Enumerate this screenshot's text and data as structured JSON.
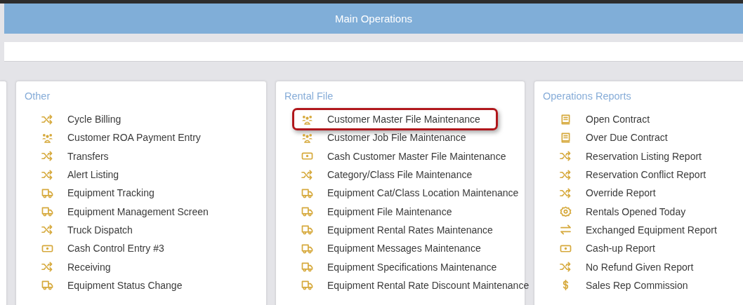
{
  "header": {
    "title": "Main Operations"
  },
  "panels": [
    {
      "title": "Other",
      "items": [
        {
          "label": "Cycle Billing",
          "kind": "shuffle",
          "highlighted": false
        },
        {
          "label": "Customer ROA Payment Entry",
          "kind": "users",
          "highlighted": false
        },
        {
          "label": "Transfers",
          "kind": "shuffle",
          "highlighted": false
        },
        {
          "label": "Alert Listing",
          "kind": "shuffle",
          "highlighted": false
        },
        {
          "label": "Equipment Tracking",
          "kind": "truck",
          "highlighted": false
        },
        {
          "label": "Equipment Management Screen",
          "kind": "truck",
          "highlighted": false
        },
        {
          "label": "Truck Dispatch",
          "kind": "shuffle",
          "highlighted": false
        },
        {
          "label": "Cash Control Entry #3",
          "kind": "cash",
          "highlighted": false
        },
        {
          "label": "Receiving",
          "kind": "shuffle",
          "highlighted": false
        },
        {
          "label": "Equipment Status Change",
          "kind": "truck",
          "highlighted": false
        }
      ]
    },
    {
      "title": "Rental File",
      "items": [
        {
          "label": "Customer Master File Maintenance",
          "kind": "users",
          "highlighted": true
        },
        {
          "label": "Customer Job File Maintenance",
          "kind": "users",
          "highlighted": false
        },
        {
          "label": "Cash Customer Master File Maintenance",
          "kind": "cash",
          "highlighted": false
        },
        {
          "label": "Category/Class File Maintenance",
          "kind": "shuffle",
          "highlighted": false
        },
        {
          "label": "Equipment Cat/Class Location Maintenance",
          "kind": "truck",
          "highlighted": false
        },
        {
          "label": "Equipment File Maintenance",
          "kind": "truck",
          "highlighted": false
        },
        {
          "label": "Equipment Rental Rates Maintenance",
          "kind": "truck",
          "highlighted": false
        },
        {
          "label": "Equipment Messages Maintenance",
          "kind": "truck",
          "highlighted": false
        },
        {
          "label": "Equipment Specifications Maintenance",
          "kind": "truck",
          "highlighted": false
        },
        {
          "label": "Equipment Rental Rate Discount Maintenance",
          "kind": "truck",
          "highlighted": false
        }
      ]
    },
    {
      "title": "Operations Reports",
      "items": [
        {
          "label": "Open Contract",
          "kind": "contract",
          "highlighted": false
        },
        {
          "label": "Over Due Contract",
          "kind": "contract",
          "highlighted": false
        },
        {
          "label": "Reservation Listing Report",
          "kind": "shuffle",
          "highlighted": false
        },
        {
          "label": "Reservation Conflict Report",
          "kind": "shuffle",
          "highlighted": false
        },
        {
          "label": "Override Report",
          "kind": "shuffle",
          "highlighted": false
        },
        {
          "label": "Rentals Opened Today",
          "kind": "gear",
          "highlighted": false
        },
        {
          "label": "Exchanged Equipment Report",
          "kind": "exchange",
          "highlighted": false
        },
        {
          "label": "Cash-up Report",
          "kind": "cash",
          "highlighted": false
        },
        {
          "label": "No Refund Given Report",
          "kind": "shuffle",
          "highlighted": false
        },
        {
          "label": "Sales Rep Commission",
          "kind": "dollar",
          "highlighted": false
        }
      ]
    }
  ]
}
